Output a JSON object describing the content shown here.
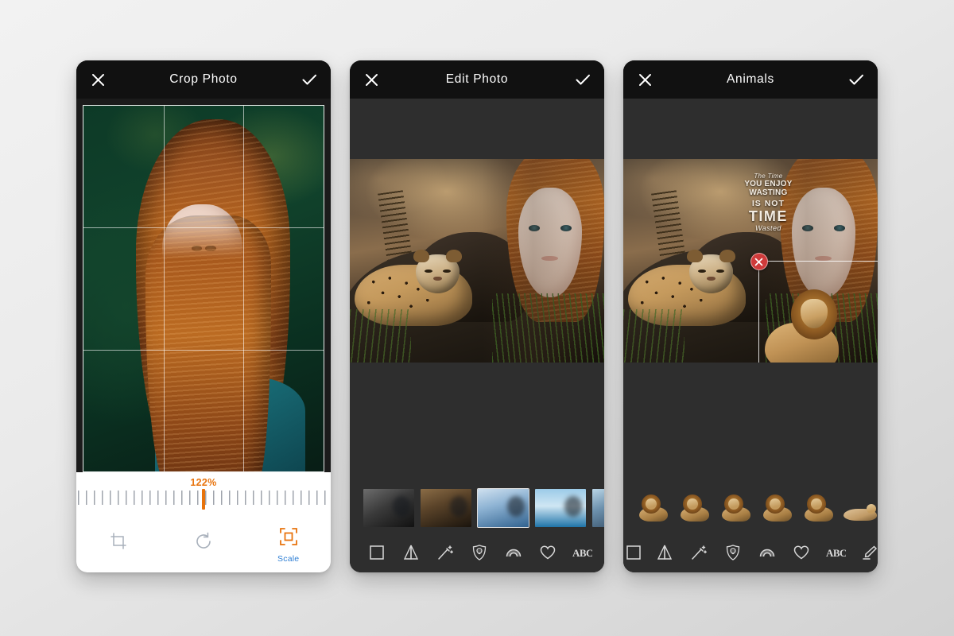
{
  "app": {
    "background_color": "#e8e8e8",
    "accent_orange": "#e8730c",
    "accent_blue": "#2f7fd4",
    "delete_red": "#cf3b3b"
  },
  "panels": {
    "crop": {
      "header": {
        "title": "Crop Photo",
        "close_icon": "close-icon",
        "confirm_icon": "check-icon"
      },
      "canvas": {
        "name": "crop-canvas",
        "grid": "rule-of-thirds",
        "subject": "portrait-red-haired-woman"
      },
      "ruler": {
        "value_label": "122%",
        "value_percent": 122,
        "indicator_position_percent": 50
      },
      "tools": [
        {
          "name": "crop-tool",
          "icon": "crop-icon",
          "label": "",
          "active": false
        },
        {
          "name": "rotate-tool",
          "icon": "rotate-icon",
          "label": "",
          "active": false
        },
        {
          "name": "scale-tool",
          "icon": "scale-icon",
          "label": "Scale",
          "active": true
        }
      ]
    },
    "edit": {
      "header": {
        "title": "Edit Photo",
        "close_icon": "close-icon",
        "confirm_icon": "check-icon"
      },
      "canvas": {
        "name": "edit-canvas",
        "subject": "jaguar-and-woman-composite"
      },
      "filmstrip": [
        {
          "name": "thumbnail-bw-wolf",
          "selected": false
        },
        {
          "name": "thumbnail-jaguar-rocks",
          "selected": false
        },
        {
          "name": "thumbnail-blue-wolf-snow",
          "selected": true
        },
        {
          "name": "thumbnail-dove-sky",
          "selected": false
        },
        {
          "name": "thumbnail-eagle-flight",
          "selected": false
        }
      ],
      "tools": [
        {
          "name": "frame-tool",
          "icon": "square-frame-icon"
        },
        {
          "name": "mirror-tool",
          "icon": "mirror-flip-icon"
        },
        {
          "name": "effects-tool",
          "icon": "magic-wand-icon"
        },
        {
          "name": "stickers-tool",
          "icon": "lion-shield-icon"
        },
        {
          "name": "gradient-tool",
          "icon": "arc-gradient-icon"
        },
        {
          "name": "shape-tool",
          "icon": "heart-icon"
        },
        {
          "name": "text-tool",
          "icon": "abc-text-icon"
        },
        {
          "name": "draw-tool",
          "icon": "pencil-icon"
        }
      ]
    },
    "animals": {
      "header": {
        "title": "Animals",
        "close_icon": "close-icon",
        "confirm_icon": "check-icon"
      },
      "canvas": {
        "name": "animals-canvas",
        "subject": "jaguar-and-woman-composite"
      },
      "quote_overlay": {
        "line1": "The Time",
        "line2": "YOU ENJOY WASTING",
        "line3": "IS NOT",
        "line4": "TIME",
        "line5": "Wasted"
      },
      "selection": {
        "name": "sticker-selection-frame",
        "delete_icon": "delete-x-icon"
      },
      "sticker_strip": [
        {
          "name": "sticker-lion-sitting",
          "type": "lion"
        },
        {
          "name": "sticker-lion-lying",
          "type": "lion"
        },
        {
          "name": "sticker-lion-standing",
          "type": "lion"
        },
        {
          "name": "sticker-lion-walking",
          "type": "lion"
        },
        {
          "name": "sticker-lion-prowling",
          "type": "lion"
        },
        {
          "name": "sticker-tiger-resting",
          "type": "tiger"
        }
      ],
      "tools": [
        {
          "name": "frame-tool",
          "icon": "square-frame-icon"
        },
        {
          "name": "mirror-tool",
          "icon": "mirror-flip-icon"
        },
        {
          "name": "effects-tool",
          "icon": "magic-wand-icon"
        },
        {
          "name": "stickers-tool",
          "icon": "lion-shield-icon"
        },
        {
          "name": "gradient-tool",
          "icon": "arc-gradient-icon"
        },
        {
          "name": "shape-tool",
          "icon": "heart-icon"
        },
        {
          "name": "text-tool",
          "icon": "abc-text-icon"
        },
        {
          "name": "draw-tool",
          "icon": "pencil-icon"
        }
      ]
    }
  }
}
